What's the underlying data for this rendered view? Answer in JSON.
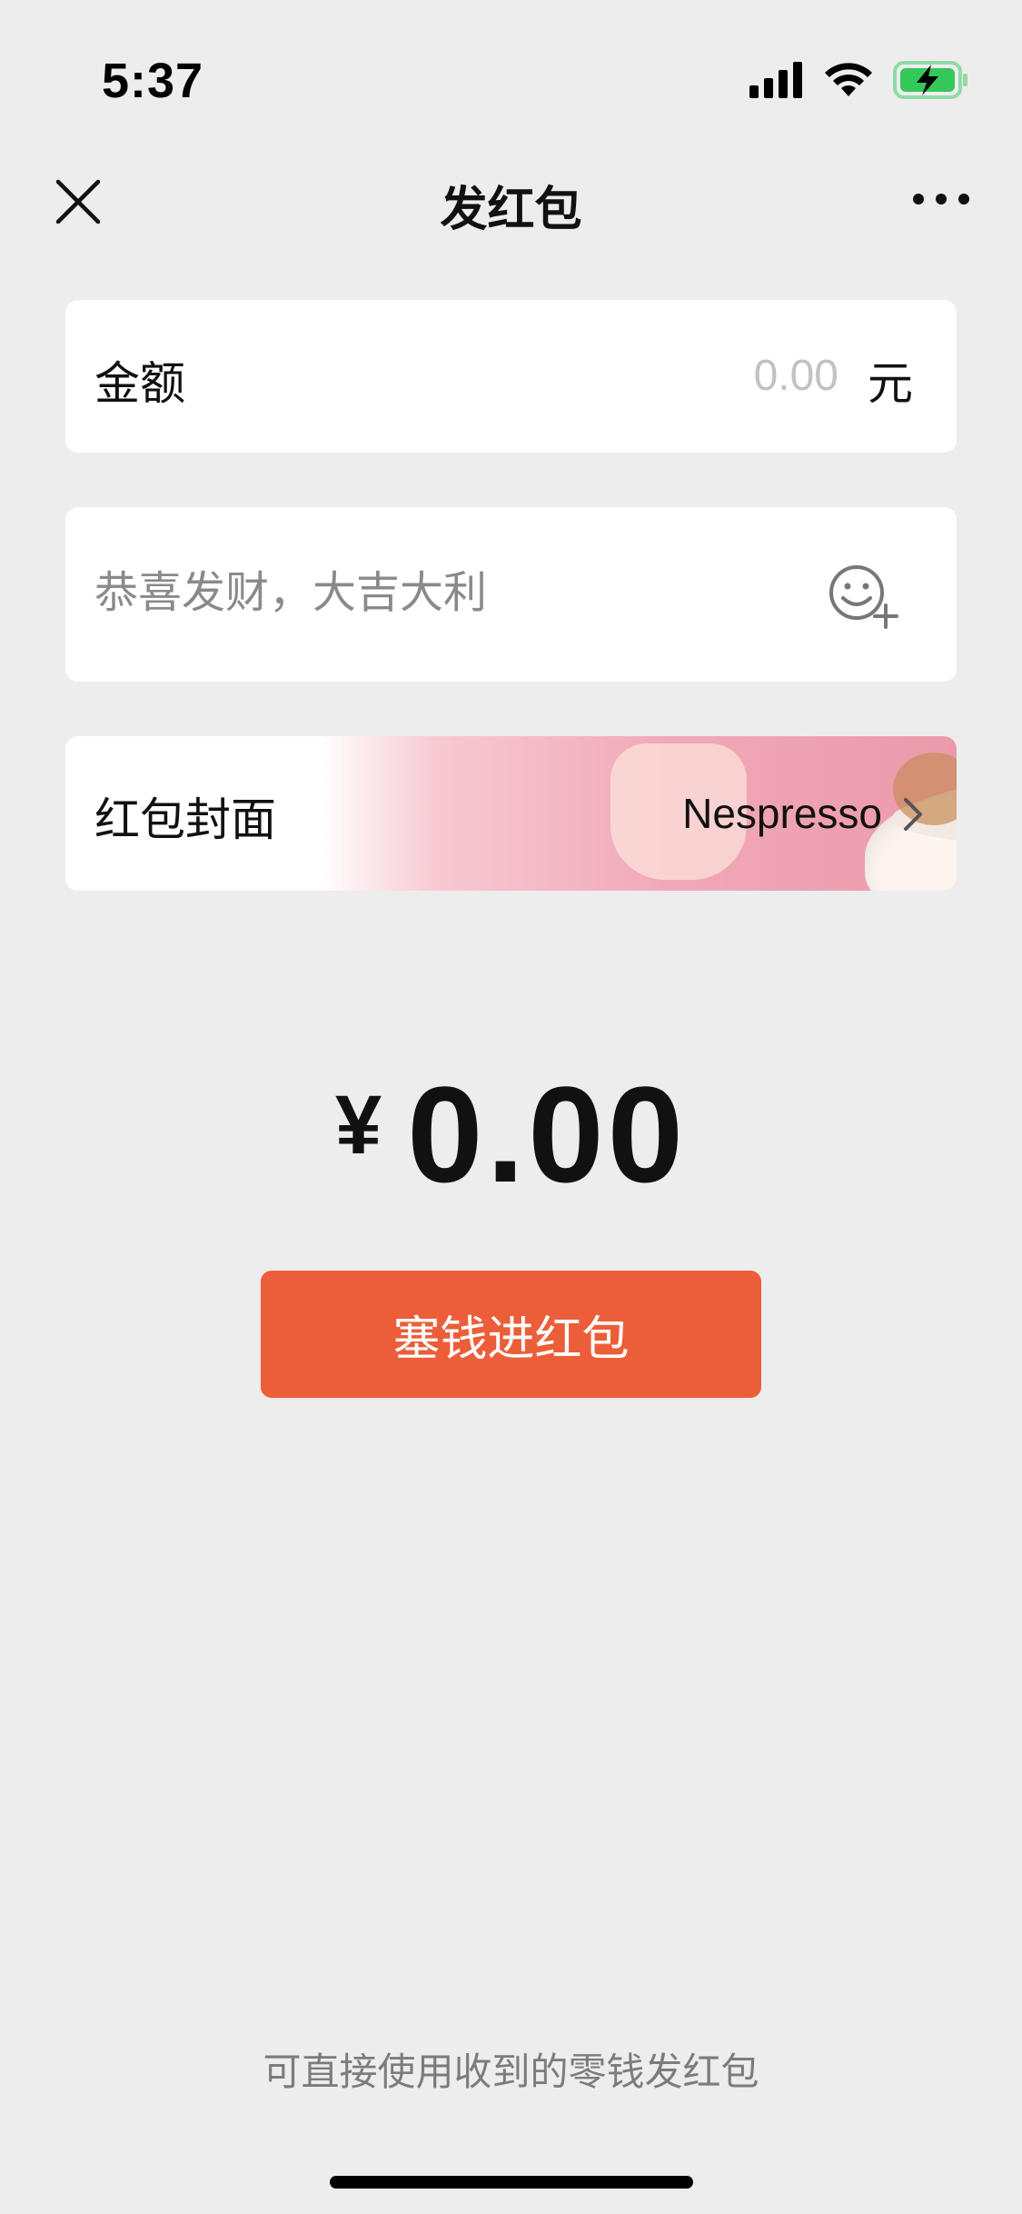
{
  "status": {
    "time": "5:37"
  },
  "nav": {
    "title": "发红包"
  },
  "amount": {
    "label": "金额",
    "placeholder": "0.00",
    "unit": "元"
  },
  "greeting": {
    "placeholder": "恭喜发财，大吉大利"
  },
  "cover": {
    "label": "红包封面",
    "name": "Nespresso"
  },
  "summary": {
    "currency": "¥",
    "total": "0.00"
  },
  "submit": {
    "label": "塞钱进红包"
  },
  "footer": {
    "note": "可直接使用收到的零钱发红包"
  },
  "colors": {
    "accent": "#ec5e3a",
    "background": "#ededed",
    "battery": "#34c759"
  }
}
